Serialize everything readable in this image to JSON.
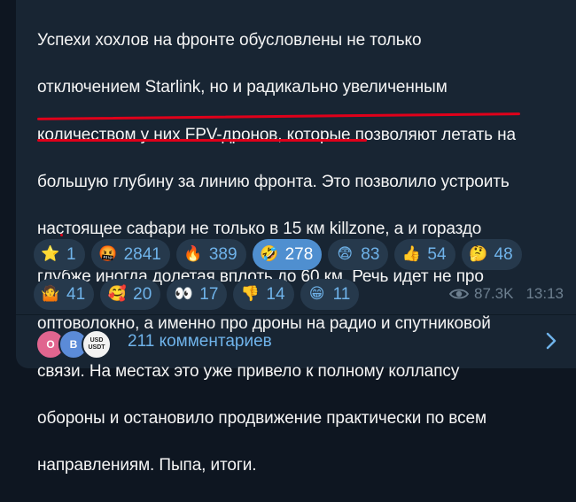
{
  "message": {
    "lines": [
      "Успехи хохлов на фронте обусловлены не только",
      "отключением Starlink, но и радикально увеличенным",
      "количеством у них FPV-дронов, которые позволяют летать на",
      "большую глубину за линию фронта. Это позволило устроить",
      "настоящее сафари не только в 15 км killzone, а и гораздо",
      "глубже иногда долетая вплоть до 60 км. Речь идет не про",
      "оптоволокно, а именно про дроны на радио и спутниковой",
      "связи. На местах это уже привело к полному коллапсу",
      "обороны и остановило продвижение практически по всем",
      "направлениям. Пыпа, итоги."
    ]
  },
  "reactions": [
    {
      "icon": "star-icon",
      "emoji": "⭐",
      "count": "1",
      "active": false
    },
    {
      "icon": "angry-face-icon",
      "emoji": "🤬",
      "count": "2841",
      "active": false
    },
    {
      "icon": "fire-icon",
      "emoji": "🔥",
      "count": "389",
      "active": false
    },
    {
      "icon": "rolling-laughing-icon",
      "emoji": "🤣",
      "count": "278",
      "active": true
    },
    {
      "icon": "fearful-face-icon",
      "emoji": "😨",
      "count": "83",
      "active": false
    },
    {
      "icon": "thumbs-up-icon",
      "emoji": "👍",
      "count": "54",
      "active": false
    },
    {
      "icon": "thinking-face-icon",
      "emoji": "🤔",
      "count": "48",
      "active": false
    },
    {
      "icon": "shrugging-person-icon",
      "emoji": "🤷",
      "count": "41",
      "active": false
    },
    {
      "icon": "smiling-hearts-icon",
      "emoji": "🥰",
      "count": "20",
      "active": false
    },
    {
      "icon": "eyes-icon",
      "emoji": "👀",
      "count": "17",
      "active": false
    },
    {
      "icon": "thumbs-down-icon",
      "emoji": "👎",
      "count": "14",
      "active": false
    },
    {
      "icon": "grinning-face-icon",
      "emoji": "😁",
      "count": "11",
      "active": false
    }
  ],
  "meta": {
    "views": "87.3K",
    "time": "13:13"
  },
  "comments": {
    "label": "211 комментариев",
    "avatars": [
      {
        "letter": "O",
        "color": "#e0658f"
      },
      {
        "letter": "B",
        "color": "#5b8bd8"
      },
      {
        "letter": "USD USDT",
        "color": "#f2f2f2"
      }
    ]
  },
  "colors": {
    "underline": "#e0001a",
    "link": "#6fb3ea",
    "bubble": "#182533"
  }
}
